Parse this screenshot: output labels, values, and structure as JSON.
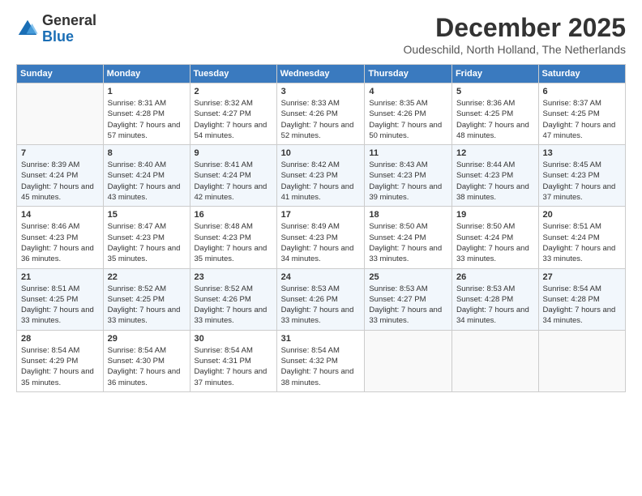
{
  "logo": {
    "general": "General",
    "blue": "Blue"
  },
  "header": {
    "month": "December 2025",
    "location": "Oudeschild, North Holland, The Netherlands"
  },
  "weekdays": [
    "Sunday",
    "Monday",
    "Tuesday",
    "Wednesday",
    "Thursday",
    "Friday",
    "Saturday"
  ],
  "weeks": [
    [
      {
        "day": "",
        "sunrise": "",
        "sunset": "",
        "daylight": ""
      },
      {
        "day": "1",
        "sunrise": "Sunrise: 8:31 AM",
        "sunset": "Sunset: 4:28 PM",
        "daylight": "Daylight: 7 hours and 57 minutes."
      },
      {
        "day": "2",
        "sunrise": "Sunrise: 8:32 AM",
        "sunset": "Sunset: 4:27 PM",
        "daylight": "Daylight: 7 hours and 54 minutes."
      },
      {
        "day": "3",
        "sunrise": "Sunrise: 8:33 AM",
        "sunset": "Sunset: 4:26 PM",
        "daylight": "Daylight: 7 hours and 52 minutes."
      },
      {
        "day": "4",
        "sunrise": "Sunrise: 8:35 AM",
        "sunset": "Sunset: 4:26 PM",
        "daylight": "Daylight: 7 hours and 50 minutes."
      },
      {
        "day": "5",
        "sunrise": "Sunrise: 8:36 AM",
        "sunset": "Sunset: 4:25 PM",
        "daylight": "Daylight: 7 hours and 48 minutes."
      },
      {
        "day": "6",
        "sunrise": "Sunrise: 8:37 AM",
        "sunset": "Sunset: 4:25 PM",
        "daylight": "Daylight: 7 hours and 47 minutes."
      }
    ],
    [
      {
        "day": "7",
        "sunrise": "Sunrise: 8:39 AM",
        "sunset": "Sunset: 4:24 PM",
        "daylight": "Daylight: 7 hours and 45 minutes."
      },
      {
        "day": "8",
        "sunrise": "Sunrise: 8:40 AM",
        "sunset": "Sunset: 4:24 PM",
        "daylight": "Daylight: 7 hours and 43 minutes."
      },
      {
        "day": "9",
        "sunrise": "Sunrise: 8:41 AM",
        "sunset": "Sunset: 4:24 PM",
        "daylight": "Daylight: 7 hours and 42 minutes."
      },
      {
        "day": "10",
        "sunrise": "Sunrise: 8:42 AM",
        "sunset": "Sunset: 4:23 PM",
        "daylight": "Daylight: 7 hours and 41 minutes."
      },
      {
        "day": "11",
        "sunrise": "Sunrise: 8:43 AM",
        "sunset": "Sunset: 4:23 PM",
        "daylight": "Daylight: 7 hours and 39 minutes."
      },
      {
        "day": "12",
        "sunrise": "Sunrise: 8:44 AM",
        "sunset": "Sunset: 4:23 PM",
        "daylight": "Daylight: 7 hours and 38 minutes."
      },
      {
        "day": "13",
        "sunrise": "Sunrise: 8:45 AM",
        "sunset": "Sunset: 4:23 PM",
        "daylight": "Daylight: 7 hours and 37 minutes."
      }
    ],
    [
      {
        "day": "14",
        "sunrise": "Sunrise: 8:46 AM",
        "sunset": "Sunset: 4:23 PM",
        "daylight": "Daylight: 7 hours and 36 minutes."
      },
      {
        "day": "15",
        "sunrise": "Sunrise: 8:47 AM",
        "sunset": "Sunset: 4:23 PM",
        "daylight": "Daylight: 7 hours and 35 minutes."
      },
      {
        "day": "16",
        "sunrise": "Sunrise: 8:48 AM",
        "sunset": "Sunset: 4:23 PM",
        "daylight": "Daylight: 7 hours and 35 minutes."
      },
      {
        "day": "17",
        "sunrise": "Sunrise: 8:49 AM",
        "sunset": "Sunset: 4:23 PM",
        "daylight": "Daylight: 7 hours and 34 minutes."
      },
      {
        "day": "18",
        "sunrise": "Sunrise: 8:50 AM",
        "sunset": "Sunset: 4:24 PM",
        "daylight": "Daylight: 7 hours and 33 minutes."
      },
      {
        "day": "19",
        "sunrise": "Sunrise: 8:50 AM",
        "sunset": "Sunset: 4:24 PM",
        "daylight": "Daylight: 7 hours and 33 minutes."
      },
      {
        "day": "20",
        "sunrise": "Sunrise: 8:51 AM",
        "sunset": "Sunset: 4:24 PM",
        "daylight": "Daylight: 7 hours and 33 minutes."
      }
    ],
    [
      {
        "day": "21",
        "sunrise": "Sunrise: 8:51 AM",
        "sunset": "Sunset: 4:25 PM",
        "daylight": "Daylight: 7 hours and 33 minutes."
      },
      {
        "day": "22",
        "sunrise": "Sunrise: 8:52 AM",
        "sunset": "Sunset: 4:25 PM",
        "daylight": "Daylight: 7 hours and 33 minutes."
      },
      {
        "day": "23",
        "sunrise": "Sunrise: 8:52 AM",
        "sunset": "Sunset: 4:26 PM",
        "daylight": "Daylight: 7 hours and 33 minutes."
      },
      {
        "day": "24",
        "sunrise": "Sunrise: 8:53 AM",
        "sunset": "Sunset: 4:26 PM",
        "daylight": "Daylight: 7 hours and 33 minutes."
      },
      {
        "day": "25",
        "sunrise": "Sunrise: 8:53 AM",
        "sunset": "Sunset: 4:27 PM",
        "daylight": "Daylight: 7 hours and 33 minutes."
      },
      {
        "day": "26",
        "sunrise": "Sunrise: 8:53 AM",
        "sunset": "Sunset: 4:28 PM",
        "daylight": "Daylight: 7 hours and 34 minutes."
      },
      {
        "day": "27",
        "sunrise": "Sunrise: 8:54 AM",
        "sunset": "Sunset: 4:28 PM",
        "daylight": "Daylight: 7 hours and 34 minutes."
      }
    ],
    [
      {
        "day": "28",
        "sunrise": "Sunrise: 8:54 AM",
        "sunset": "Sunset: 4:29 PM",
        "daylight": "Daylight: 7 hours and 35 minutes."
      },
      {
        "day": "29",
        "sunrise": "Sunrise: 8:54 AM",
        "sunset": "Sunset: 4:30 PM",
        "daylight": "Daylight: 7 hours and 36 minutes."
      },
      {
        "day": "30",
        "sunrise": "Sunrise: 8:54 AM",
        "sunset": "Sunset: 4:31 PM",
        "daylight": "Daylight: 7 hours and 37 minutes."
      },
      {
        "day": "31",
        "sunrise": "Sunrise: 8:54 AM",
        "sunset": "Sunset: 4:32 PM",
        "daylight": "Daylight: 7 hours and 38 minutes."
      },
      {
        "day": "",
        "sunrise": "",
        "sunset": "",
        "daylight": ""
      },
      {
        "day": "",
        "sunrise": "",
        "sunset": "",
        "daylight": ""
      },
      {
        "day": "",
        "sunrise": "",
        "sunset": "",
        "daylight": ""
      }
    ]
  ]
}
